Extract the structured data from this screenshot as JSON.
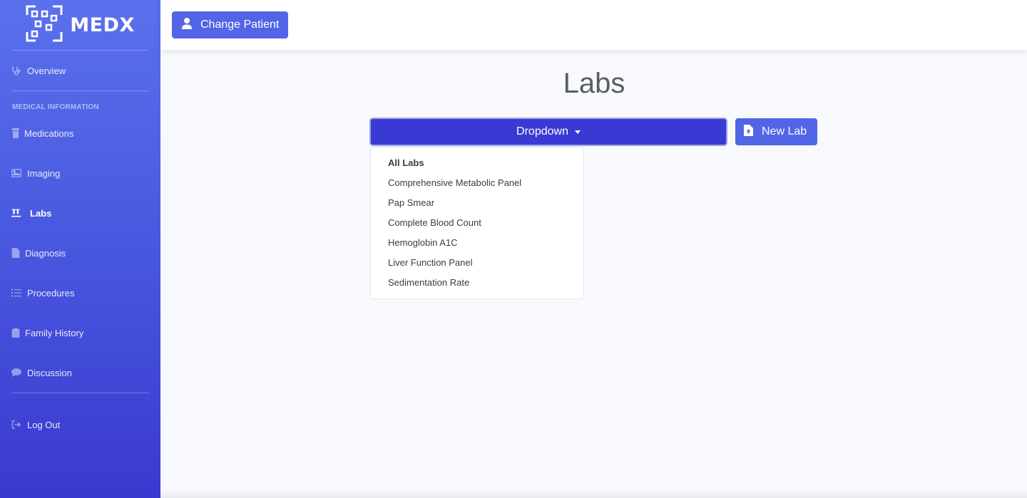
{
  "brand": {
    "name": "MEDX",
    "icon": "qr-frame-logo"
  },
  "sidebar": {
    "overview": {
      "label": "Overview",
      "icon": "stethoscope-icon"
    },
    "section_heading": "MEDICAL INFORMATION",
    "items": [
      {
        "label": "Medications",
        "icon": "prescription-bottle-icon"
      },
      {
        "label": "Imaging",
        "icon": "image-icon"
      },
      {
        "label": "Labs",
        "icon": "vials-icon",
        "active": true
      },
      {
        "label": "Diagnosis",
        "icon": "file-icon"
      },
      {
        "label": "Procedures",
        "icon": "list-icon"
      },
      {
        "label": "Family History",
        "icon": "clipboard-icon"
      },
      {
        "label": "Discussion",
        "icon": "comment-icon"
      }
    ],
    "logout": {
      "label": "Log Out",
      "icon": "sign-out-icon"
    }
  },
  "topbar": {
    "change_patient_label": "Change Patient",
    "change_patient_icon": "user-icon"
  },
  "main": {
    "title": "Labs",
    "dropdown_label": "Dropdown",
    "new_lab_label": "New Lab",
    "new_lab_icon": "file-upload-icon",
    "dropdown_items": [
      "All Labs",
      "Comprehensive Metabolic Panel",
      "Pap Smear",
      "Complete Blood Count",
      "Hemoglobin A1C",
      "Liver Function Panel",
      "Sedimentation Rate"
    ]
  },
  "colors": {
    "primary": "#5265e6",
    "dropdown_active": "#3a39d4",
    "sidebar_top": "#5a70ec",
    "sidebar_bottom": "#3a39cf",
    "title_text": "#5a5c69",
    "background": "#f8f9fc"
  }
}
